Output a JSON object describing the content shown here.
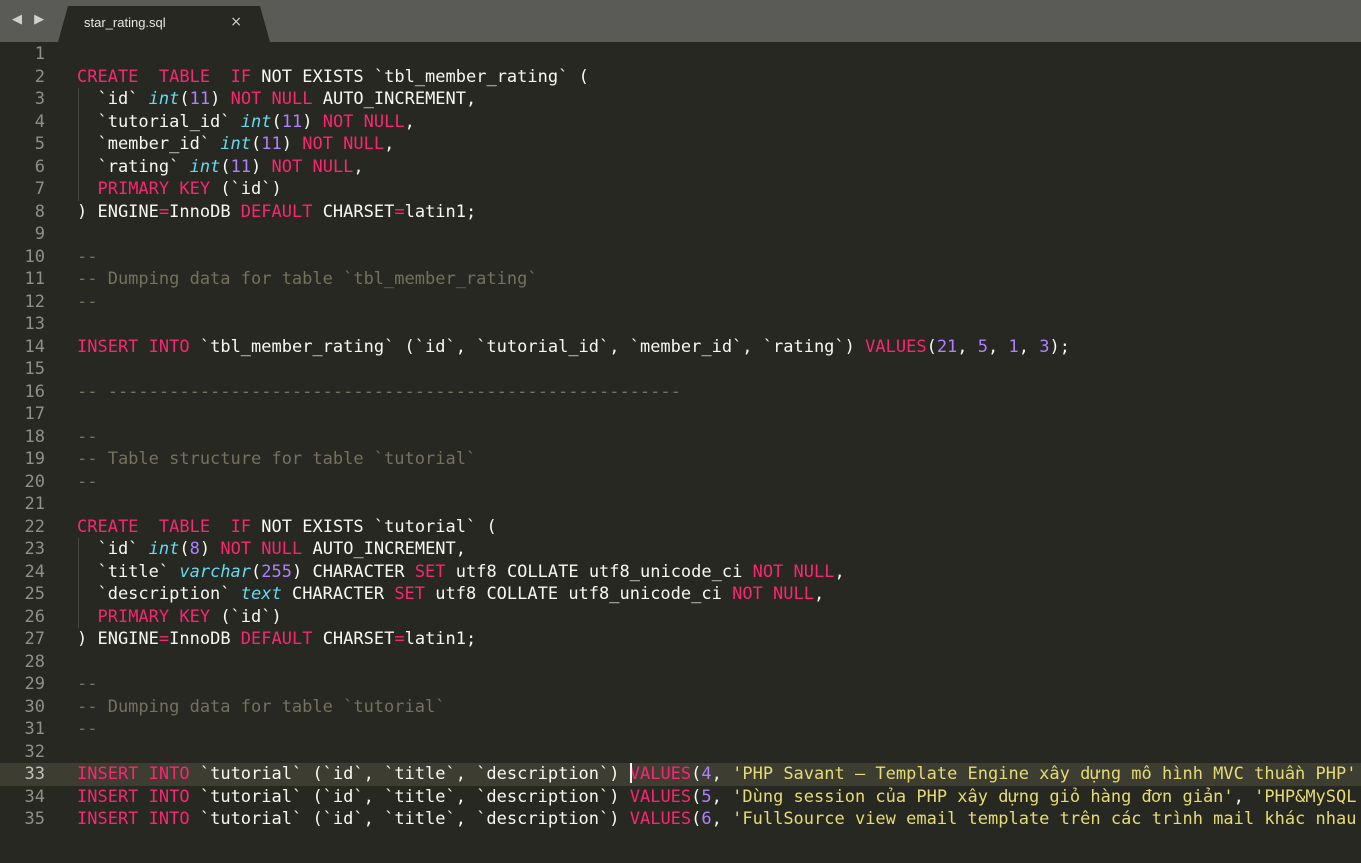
{
  "tabbar": {
    "nav_arrows": "◀ ▶",
    "tab_title": "star_rating.sql",
    "close_glyph": "×"
  },
  "editor": {
    "active_line": 33,
    "lines": [
      {
        "n": "1",
        "t": []
      },
      {
        "n": "2",
        "t": [
          [
            "kw",
            "CREATE"
          ],
          [
            "",
            "  "
          ],
          [
            "kw",
            "TABLE"
          ],
          [
            "",
            "  "
          ],
          [
            "kw",
            "IF"
          ],
          [
            "",
            " NOT EXISTS `tbl_member_rating` ("
          ]
        ]
      },
      {
        "n": "3",
        "t": [
          [
            "",
            "  `id` "
          ],
          [
            "type",
            "int"
          ],
          [
            "",
            "("
          ],
          [
            "num",
            "11"
          ],
          [
            "",
            ") "
          ],
          [
            "kw",
            "NOT NULL"
          ],
          [
            "",
            " AUTO_INCREMENT,"
          ]
        ]
      },
      {
        "n": "4",
        "t": [
          [
            "",
            "  `tutorial_id` "
          ],
          [
            "type",
            "int"
          ],
          [
            "",
            "("
          ],
          [
            "num",
            "11"
          ],
          [
            "",
            ") "
          ],
          [
            "kw",
            "NOT NULL"
          ],
          [
            "",
            ","
          ]
        ]
      },
      {
        "n": "5",
        "t": [
          [
            "",
            "  `member_id` "
          ],
          [
            "type",
            "int"
          ],
          [
            "",
            "("
          ],
          [
            "num",
            "11"
          ],
          [
            "",
            ") "
          ],
          [
            "kw",
            "NOT NULL"
          ],
          [
            "",
            ","
          ]
        ]
      },
      {
        "n": "6",
        "t": [
          [
            "",
            "  `rating` "
          ],
          [
            "type",
            "int"
          ],
          [
            "",
            "("
          ],
          [
            "num",
            "11"
          ],
          [
            "",
            ") "
          ],
          [
            "kw",
            "NOT NULL"
          ],
          [
            "",
            ","
          ]
        ]
      },
      {
        "n": "7",
        "t": [
          [
            "",
            "  "
          ],
          [
            "kw",
            "PRIMARY KEY"
          ],
          [
            "",
            " (`id`)"
          ]
        ]
      },
      {
        "n": "8",
        "t": [
          [
            "",
            ") ENGINE"
          ],
          [
            "op",
            "="
          ],
          [
            "",
            "InnoDB "
          ],
          [
            "kw",
            "DEFAULT"
          ],
          [
            "",
            " CHARSET"
          ],
          [
            "op",
            "="
          ],
          [
            "",
            "latin1;"
          ]
        ]
      },
      {
        "n": "9",
        "t": []
      },
      {
        "n": "10",
        "t": [
          [
            "cmt",
            "--"
          ]
        ]
      },
      {
        "n": "11",
        "t": [
          [
            "cmt",
            "-- Dumping data for table `tbl_member_rating`"
          ]
        ]
      },
      {
        "n": "12",
        "t": [
          [
            "cmt",
            "--"
          ]
        ]
      },
      {
        "n": "13",
        "t": []
      },
      {
        "n": "14",
        "t": [
          [
            "kw",
            "INSERT"
          ],
          [
            "",
            " "
          ],
          [
            "kw",
            "INTO"
          ],
          [
            "",
            " `tbl_member_rating` (`id`, `tutorial_id`, `member_id`, `rating`) "
          ],
          [
            "kw",
            "VALUES"
          ],
          [
            "",
            "("
          ],
          [
            "num",
            "21"
          ],
          [
            "",
            ", "
          ],
          [
            "num",
            "5"
          ],
          [
            "",
            ", "
          ],
          [
            "num",
            "1"
          ],
          [
            "",
            ", "
          ],
          [
            "num",
            "3"
          ],
          [
            "",
            ");"
          ]
        ]
      },
      {
        "n": "15",
        "t": []
      },
      {
        "n": "16",
        "t": [
          [
            "cmt",
            "-- --------------------------------------------------------"
          ]
        ]
      },
      {
        "n": "17",
        "t": []
      },
      {
        "n": "18",
        "t": [
          [
            "cmt",
            "--"
          ]
        ]
      },
      {
        "n": "19",
        "t": [
          [
            "cmt",
            "-- Table structure for table `tutorial`"
          ]
        ]
      },
      {
        "n": "20",
        "t": [
          [
            "cmt",
            "--"
          ]
        ]
      },
      {
        "n": "21",
        "t": []
      },
      {
        "n": "22",
        "t": [
          [
            "kw",
            "CREATE"
          ],
          [
            "",
            "  "
          ],
          [
            "kw",
            "TABLE"
          ],
          [
            "",
            "  "
          ],
          [
            "kw",
            "IF"
          ],
          [
            "",
            " NOT EXISTS `tutorial` ("
          ]
        ]
      },
      {
        "n": "23",
        "t": [
          [
            "",
            "  `id` "
          ],
          [
            "type",
            "int"
          ],
          [
            "",
            "("
          ],
          [
            "num",
            "8"
          ],
          [
            "",
            ") "
          ],
          [
            "kw",
            "NOT NULL"
          ],
          [
            "",
            " AUTO_INCREMENT,"
          ]
        ]
      },
      {
        "n": "24",
        "t": [
          [
            "",
            "  `title` "
          ],
          [
            "type",
            "varchar"
          ],
          [
            "",
            "("
          ],
          [
            "num",
            "255"
          ],
          [
            "",
            ") CHARACTER "
          ],
          [
            "kw",
            "SET"
          ],
          [
            "",
            " utf8 COLLATE utf8_unicode_ci "
          ],
          [
            "kw",
            "NOT NULL"
          ],
          [
            "",
            ","
          ]
        ]
      },
      {
        "n": "25",
        "t": [
          [
            "",
            "  `description` "
          ],
          [
            "type",
            "text"
          ],
          [
            "",
            " CHARACTER "
          ],
          [
            "kw",
            "SET"
          ],
          [
            "",
            " utf8 COLLATE utf8_unicode_ci "
          ],
          [
            "kw",
            "NOT NULL"
          ],
          [
            "",
            ","
          ]
        ]
      },
      {
        "n": "26",
        "t": [
          [
            "",
            "  "
          ],
          [
            "kw",
            "PRIMARY KEY"
          ],
          [
            "",
            " (`id`)"
          ]
        ]
      },
      {
        "n": "27",
        "t": [
          [
            "",
            ") ENGINE"
          ],
          [
            "op",
            "="
          ],
          [
            "",
            "InnoDB "
          ],
          [
            "kw",
            "DEFAULT"
          ],
          [
            "",
            " CHARSET"
          ],
          [
            "op",
            "="
          ],
          [
            "",
            "latin1;"
          ]
        ]
      },
      {
        "n": "28",
        "t": []
      },
      {
        "n": "29",
        "t": [
          [
            "cmt",
            "--"
          ]
        ]
      },
      {
        "n": "30",
        "t": [
          [
            "cmt",
            "-- Dumping data for table `tutorial`"
          ]
        ]
      },
      {
        "n": "31",
        "t": [
          [
            "cmt",
            "--"
          ]
        ]
      },
      {
        "n": "32",
        "t": []
      },
      {
        "n": "33",
        "t": [
          [
            "kw",
            "INSERT"
          ],
          [
            "",
            " "
          ],
          [
            "kw",
            "INTO"
          ],
          [
            "",
            " `tutorial` (`id`, `title`, `description`) "
          ],
          [
            "cursor",
            ""
          ],
          [
            "kw",
            "VALUES"
          ],
          [
            "",
            "("
          ],
          [
            "num",
            "4"
          ],
          [
            "",
            ", "
          ],
          [
            "str",
            "'PHP Savant – Template Engine xây dựng mô hình MVC thuần PHP'"
          ]
        ]
      },
      {
        "n": "34",
        "t": [
          [
            "kw",
            "INSERT"
          ],
          [
            "",
            " "
          ],
          [
            "kw",
            "INTO"
          ],
          [
            "",
            " `tutorial` (`id`, `title`, `description`) "
          ],
          [
            "kw",
            "VALUES"
          ],
          [
            "",
            "("
          ],
          [
            "num",
            "5"
          ],
          [
            "",
            ", "
          ],
          [
            "str",
            "'Dùng session của PHP xây dựng giỏ hàng đơn giản'"
          ],
          [
            "",
            ", "
          ],
          [
            "str",
            "'PHP&MySQL"
          ]
        ]
      },
      {
        "n": "35",
        "t": [
          [
            "kw",
            "INSERT"
          ],
          [
            "",
            " "
          ],
          [
            "kw",
            "INTO"
          ],
          [
            "",
            " `tutorial` (`id`, `title`, `description`) "
          ],
          [
            "kw",
            "VALUES"
          ],
          [
            "",
            "("
          ],
          [
            "num",
            "6"
          ],
          [
            "",
            ", "
          ],
          [
            "str",
            "'FullSource view email template trên các trình mail khác nhau"
          ]
        ]
      }
    ]
  }
}
